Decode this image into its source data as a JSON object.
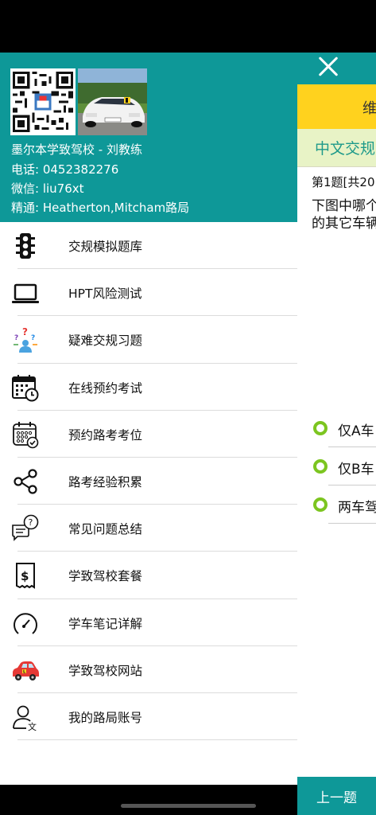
{
  "header": {
    "school_name": "墨尔本学致驾校 - 刘教练",
    "phone": "电话: 0452382276",
    "wechat": "微信: liu76xt",
    "specialty": "精通: Heatherton,Mitcham路局"
  },
  "menu": {
    "items": [
      {
        "label": "交规模拟题库",
        "icon": "traffic-light-icon"
      },
      {
        "label": "HPT风险测试",
        "icon": "laptop-icon"
      },
      {
        "label": "疑难交规习题",
        "icon": "question-person-icon"
      },
      {
        "label": "在线预约考试",
        "icon": "calendar-clock-icon"
      },
      {
        "label": "预约路考考位",
        "icon": "calendar-check-icon"
      },
      {
        "label": "路考经验积累",
        "icon": "share-icon"
      },
      {
        "label": "常见问题总结",
        "icon": "chat-question-icon"
      },
      {
        "label": "学致驾校套餐",
        "icon": "receipt-dollar-icon"
      },
      {
        "label": "学车笔记详解",
        "icon": "speedometer-icon"
      },
      {
        "label": "学致驾校网站",
        "icon": "red-car-icon"
      },
      {
        "label": "我的路局账号",
        "icon": "user-language-icon"
      }
    ]
  },
  "background": {
    "yellow_tab": "维",
    "green_tab": "中文交规",
    "question_number": "第1题[共20",
    "question_text_line1": "下图中哪个",
    "question_text_line2": "的其它车辆",
    "options": [
      "仅A车",
      "仅B车",
      "两车驾"
    ],
    "prev_button": "上一题"
  },
  "colors": {
    "teal": "#0e9898",
    "yellow": "#ffd21e",
    "light_green": "#e8f3c6",
    "radio_green": "#7cc520"
  }
}
